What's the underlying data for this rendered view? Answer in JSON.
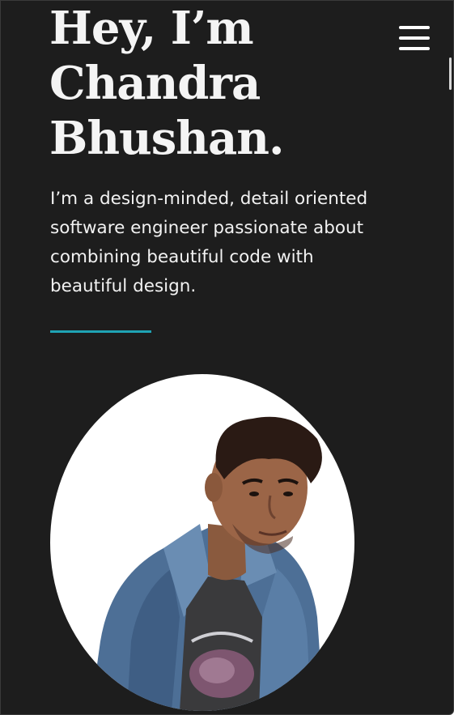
{
  "hero": {
    "title_lines": [
      "Hey, I’m",
      "Chandra",
      "Bhushan."
    ],
    "intro_lines": [
      "I’m a design-minded, detail oriented",
      "software engineer passionate about",
      "combining beautiful code with",
      "beautiful design."
    ]
  },
  "nav": {
    "menu_icon": "hamburger-menu-icon"
  },
  "colors": {
    "background": "#1d1d1d",
    "text": "#f4f4f4",
    "accent": "#1fa3b4",
    "portrait_background": "#ffffff"
  }
}
